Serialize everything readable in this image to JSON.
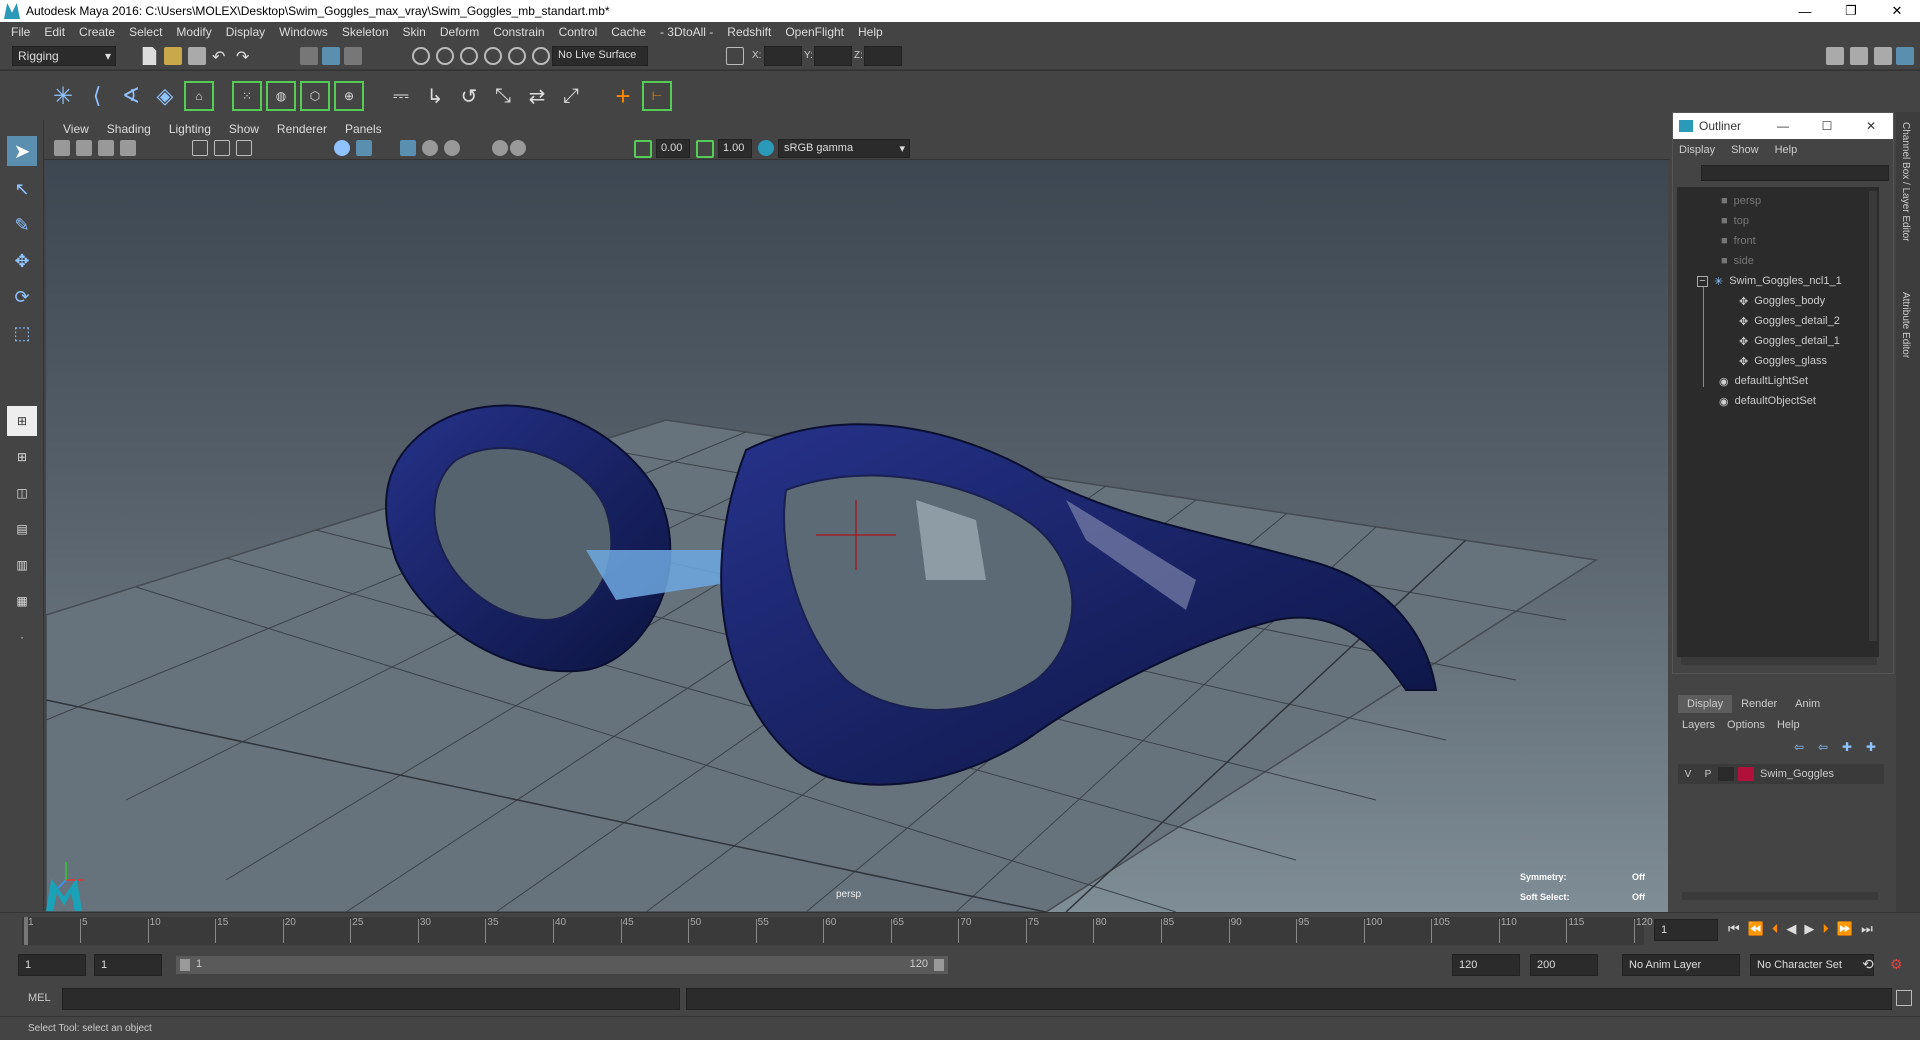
{
  "window": {
    "title": "Autodesk Maya 2016: C:\\Users\\MOLEX\\Desktop\\Swim_Goggles_max_vray\\Swim_Goggles_mb_standart.mb*",
    "minimize": "—",
    "maximize": "❐",
    "close": "✕"
  },
  "menubar": [
    "File",
    "Edit",
    "Create",
    "Select",
    "Modify",
    "Display",
    "Windows",
    "Skeleton",
    "Skin",
    "Deform",
    "Constrain",
    "Control",
    "Cache",
    "- 3DtoAll -",
    "Redshift",
    "OpenFlight",
    "Help"
  ],
  "statusline": {
    "mode": "Rigging",
    "live_surface": "No Live Surface",
    "x_label": "X:",
    "y_label": "Y:",
    "z_label": "Z:"
  },
  "viewport": {
    "menu": [
      "View",
      "Shading",
      "Lighting",
      "Show",
      "Renderer",
      "Panels"
    ],
    "exposure": "0.00",
    "gamma": "1.00",
    "color_space": "sRGB gamma",
    "camera_label": "persp",
    "symmetry_label": "Symmetry:",
    "symmetry_value": "Off",
    "soft_select_label": "Soft Select:",
    "soft_select_value": "Off"
  },
  "outliner": {
    "title": "Outliner",
    "menu": [
      "Display",
      "Show",
      "Help"
    ],
    "items": [
      {
        "label": "persp",
        "dim": true,
        "indent": 0
      },
      {
        "label": "top",
        "dim": true,
        "indent": 0
      },
      {
        "label": "front",
        "dim": true,
        "indent": 0
      },
      {
        "label": "side",
        "dim": true,
        "indent": 0
      },
      {
        "label": "Swim_Goggles_ncl1_1",
        "dim": false,
        "indent": 0
      },
      {
        "label": "Goggles_body",
        "dim": false,
        "indent": 1
      },
      {
        "label": "Goggles_detail_2",
        "dim": false,
        "indent": 1
      },
      {
        "label": "Goggles_detail_1",
        "dim": false,
        "indent": 1
      },
      {
        "label": "Goggles_glass",
        "dim": false,
        "indent": 1
      },
      {
        "label": "defaultLightSet",
        "dim": false,
        "indent": 0
      },
      {
        "label": "defaultObjectSet",
        "dim": false,
        "indent": 0
      }
    ]
  },
  "layers": {
    "tabs": [
      "Display",
      "Render",
      "Anim"
    ],
    "menu": [
      "Layers",
      "Options",
      "Help"
    ],
    "row": {
      "v": "V",
      "p": "P",
      "name": "Swim_Goggles",
      "color": "#b0103a"
    }
  },
  "rightstrip": {
    "tab1": "Channel Box / Layer Editor",
    "tab2": "Attribute Editor"
  },
  "timeline": {
    "ticks": [
      "1",
      "5",
      "10",
      "15",
      "20",
      "25",
      "30",
      "35",
      "40",
      "45",
      "50",
      "55",
      "60",
      "65",
      "70",
      "75",
      "80",
      "85",
      "90",
      "95",
      "100",
      "105",
      "110",
      "115",
      "120"
    ],
    "current_frame": "1"
  },
  "range": {
    "start": "1",
    "start2": "1",
    "slider_start": "1",
    "slider_end": "120",
    "end": "120",
    "end2": "200",
    "anim_layer": "No Anim Layer",
    "char_set": "No Character Set"
  },
  "mel": {
    "label": "MEL"
  },
  "helpline": "Select Tool: select an object"
}
